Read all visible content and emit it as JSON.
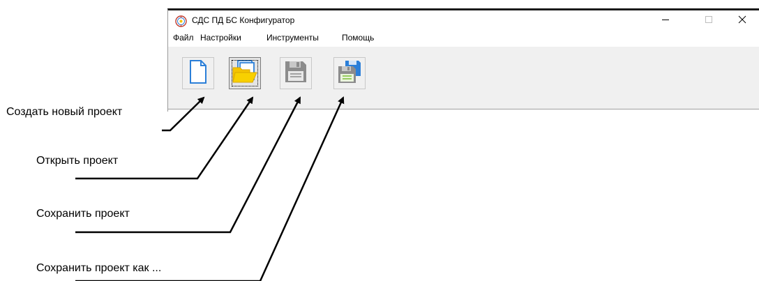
{
  "window": {
    "title": "СДС ПД БС Конфигуратор",
    "icon": "app-logo-icon",
    "controls": {
      "minimize_icon": "minimize-icon",
      "maximize_icon": "maximize-icon",
      "close_icon": "close-icon"
    }
  },
  "menu": {
    "items": [
      {
        "label": "Файл"
      },
      {
        "label": "Настройки"
      },
      {
        "label": "Инструменты"
      },
      {
        "label": "Помощь"
      }
    ]
  },
  "toolbar": {
    "buttons": [
      {
        "icon": "new-document-icon",
        "pressed": false
      },
      {
        "icon": "open-folder-icon",
        "pressed": true
      },
      {
        "icon": "save-icon",
        "pressed": false
      },
      {
        "icon": "save-as-icon",
        "pressed": false
      }
    ]
  },
  "callouts": [
    {
      "label": "Создать новый проект"
    },
    {
      "label": "Открыть проект"
    },
    {
      "label": "Сохранить проект"
    },
    {
      "label": "Сохранить проект как ..."
    }
  ],
  "colors": {
    "folder_yellow": "#f5c400",
    "document_blue": "#2b7fd8",
    "floppy_gray": "#8c8c8c",
    "toolbar_bg": "#f0f0f0"
  }
}
